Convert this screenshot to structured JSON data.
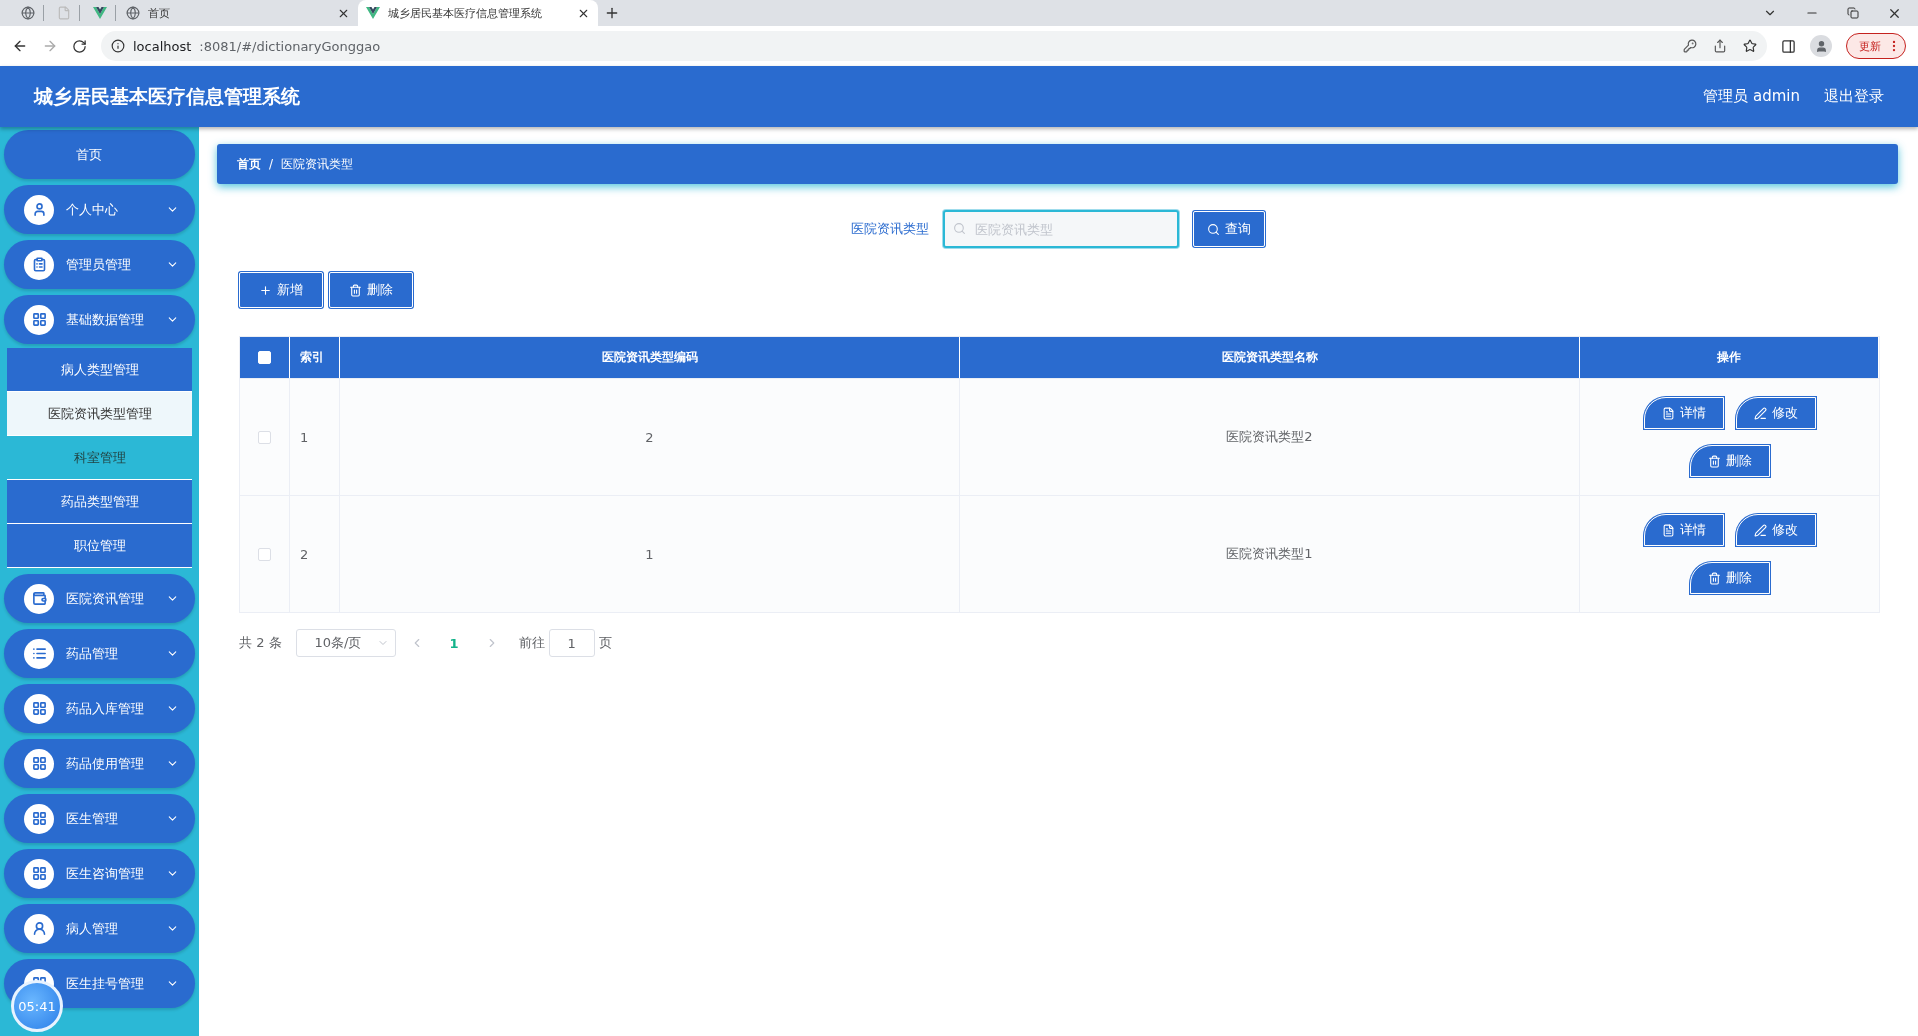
{
  "browser": {
    "tabs": [
      {
        "kind": "icon",
        "selected": false
      },
      {
        "kind": "icon",
        "selected": false
      },
      {
        "kind": "icon",
        "selected": false
      },
      {
        "kind": "page",
        "title": "首页",
        "selected": false
      },
      {
        "kind": "page",
        "title": "城乡居民基本医疗信息管理系统",
        "selected": true
      }
    ],
    "url_host": "localhost",
    "url_rest": ":8081/#/dictionaryGonggao",
    "update_button": "更新"
  },
  "header": {
    "title": "城乡居民基本医疗信息管理系统",
    "user": "管理员 admin",
    "logout": "退出登录"
  },
  "sidebar": {
    "items": [
      {
        "label": "首页",
        "kind": "home"
      },
      {
        "label": "个人中心",
        "kind": "menu"
      },
      {
        "label": "管理员管理",
        "kind": "menu"
      },
      {
        "label": "基础数据管理",
        "kind": "menu",
        "children": [
          {
            "label": "病人类型管理",
            "selected": false,
            "hovered": false
          },
          {
            "label": "医院资讯类型管理",
            "selected": true,
            "hovered": false
          },
          {
            "label": "科室管理",
            "selected": false,
            "hovered": true
          },
          {
            "label": "药品类型管理",
            "selected": false,
            "hovered": false
          },
          {
            "label": "职位管理",
            "selected": false,
            "hovered": false
          }
        ]
      },
      {
        "label": "医院资讯管理",
        "kind": "menu"
      },
      {
        "label": "药品管理",
        "kind": "menu"
      },
      {
        "label": "药品入库管理",
        "kind": "menu"
      },
      {
        "label": "药品使用管理",
        "kind": "menu"
      },
      {
        "label": "医生管理",
        "kind": "menu"
      },
      {
        "label": "医生咨询管理",
        "kind": "menu"
      },
      {
        "label": "病人管理",
        "kind": "menu"
      },
      {
        "label": "医生挂号管理",
        "kind": "menu"
      }
    ]
  },
  "breadcrumb": {
    "items": [
      "首页",
      "医院资讯类型"
    ],
    "separator": "/"
  },
  "search": {
    "label": "医院资讯类型",
    "placeholder": "医院资讯类型",
    "button": "查询"
  },
  "toolbar": [
    {
      "kind": "add",
      "label": "新增"
    },
    {
      "kind": "delete",
      "label": "删除"
    }
  ],
  "table": {
    "header_checked": false,
    "columns": [
      "索引",
      "医院资讯类型编码",
      "医院资讯类型名称",
      "操作"
    ],
    "rows": [
      {
        "checked": false,
        "index": "1",
        "code": "2",
        "name": "医院资讯类型2",
        "actions": [
          {
            "kind": "detail",
            "label": "详情"
          },
          {
            "kind": "edit",
            "label": "修改"
          },
          {
            "kind": "delete",
            "label": "删除"
          }
        ]
      },
      {
        "checked": false,
        "index": "2",
        "code": "1",
        "name": "医院资讯类型1",
        "actions": [
          {
            "kind": "detail",
            "label": "详情"
          },
          {
            "kind": "edit",
            "label": "修改"
          },
          {
            "kind": "delete",
            "label": "删除"
          }
        ]
      }
    ]
  },
  "pagination": {
    "total": "共 2 条",
    "page_size": "10条/页",
    "pages": [
      {
        "label": "1",
        "selected": true
      }
    ],
    "goto": "前往",
    "goto_value": "1",
    "page_suffix": "页"
  },
  "overlay": {
    "timer": "05:41"
  }
}
